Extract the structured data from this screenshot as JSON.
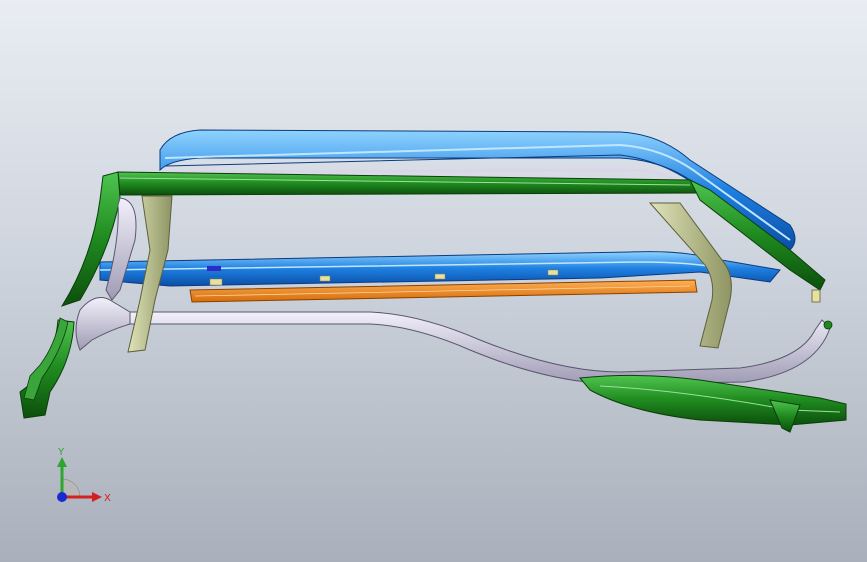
{
  "viewport": {
    "background_top": "#e9edf3",
    "background_bottom": "#a9b0bb"
  },
  "model": {
    "colors": {
      "blue_rail": "#1e7fe0",
      "blue_rail_light": "#5fb8ff",
      "green_part": "#1f8a1f",
      "green_dark": "#0f5a10",
      "gray_rail": "#c9c6d8",
      "olive_part": "#b8bf8a",
      "orange_strip": "#f08a1e",
      "cream_clip": "#e8e0a0"
    },
    "parts": [
      "blue-roof-rail-upper",
      "blue-roof-rail-lower",
      "green-front-pillar",
      "green-top-bar",
      "gray-lower-rail",
      "olive-bracket-left",
      "olive-bracket-right",
      "orange-strip",
      "green-rear-seal",
      "green-bottom-hose"
    ]
  },
  "triad": {
    "x_label": "X",
    "y_label": "Y",
    "x_color": "#d42020",
    "y_color": "#2ea52e",
    "z_color": "#1a2ad0"
  }
}
